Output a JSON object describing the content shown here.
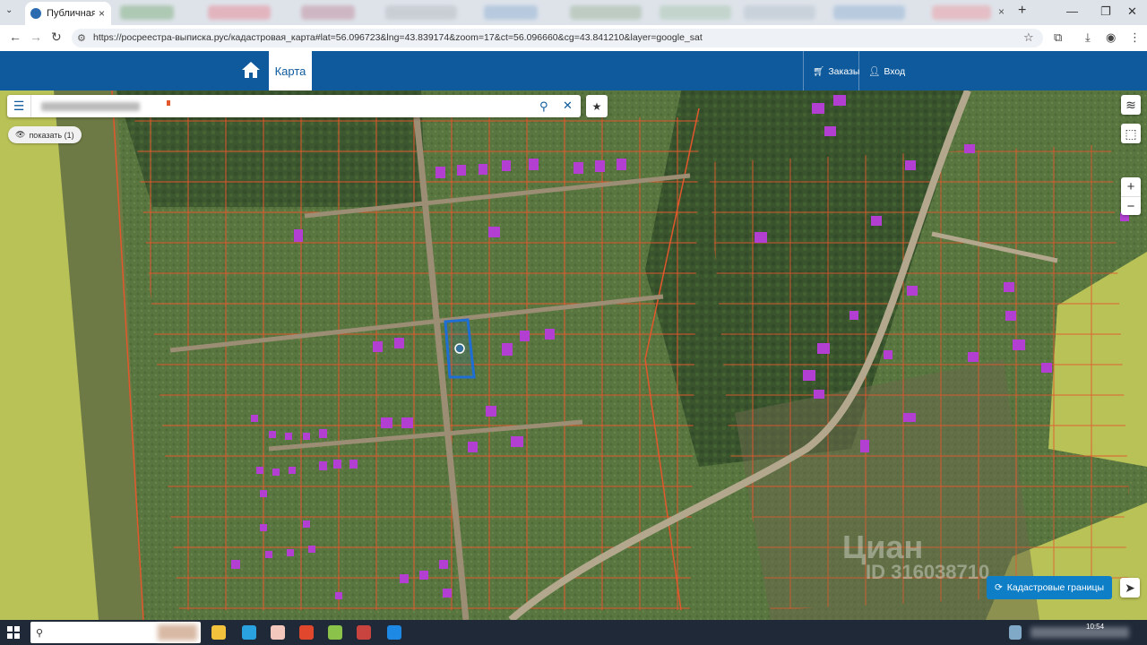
{
  "browser": {
    "active_tab_title": "Публичная ка",
    "url": "https://росреестра-выписка.рус/кадастровая_карта#lat=56.096723&lng=43.839174&zoom=17&ct=56.096660&cg=43.841210&layer=google_sat"
  },
  "site": {
    "nav_tab_label": "Карта",
    "orders_label": "Заказы",
    "login_label": "Вход"
  },
  "map": {
    "show_button_label": "показать (1)",
    "cadastral_button_label": "Кадастровые границы",
    "zoom_in_label": "+",
    "zoom_out_label": "−",
    "watermark_text": "Циан",
    "watermark_id": "ID 316038710"
  },
  "taskbar": {
    "clock": "10:54"
  },
  "colors": {
    "header_blue": "#0e5a9c",
    "accent_button": "#0e7fc7",
    "parcel_lines": "#e2572c",
    "selected_parcel": "#1f6ed4",
    "building": "#b23fd1",
    "field": "#b9c257"
  }
}
